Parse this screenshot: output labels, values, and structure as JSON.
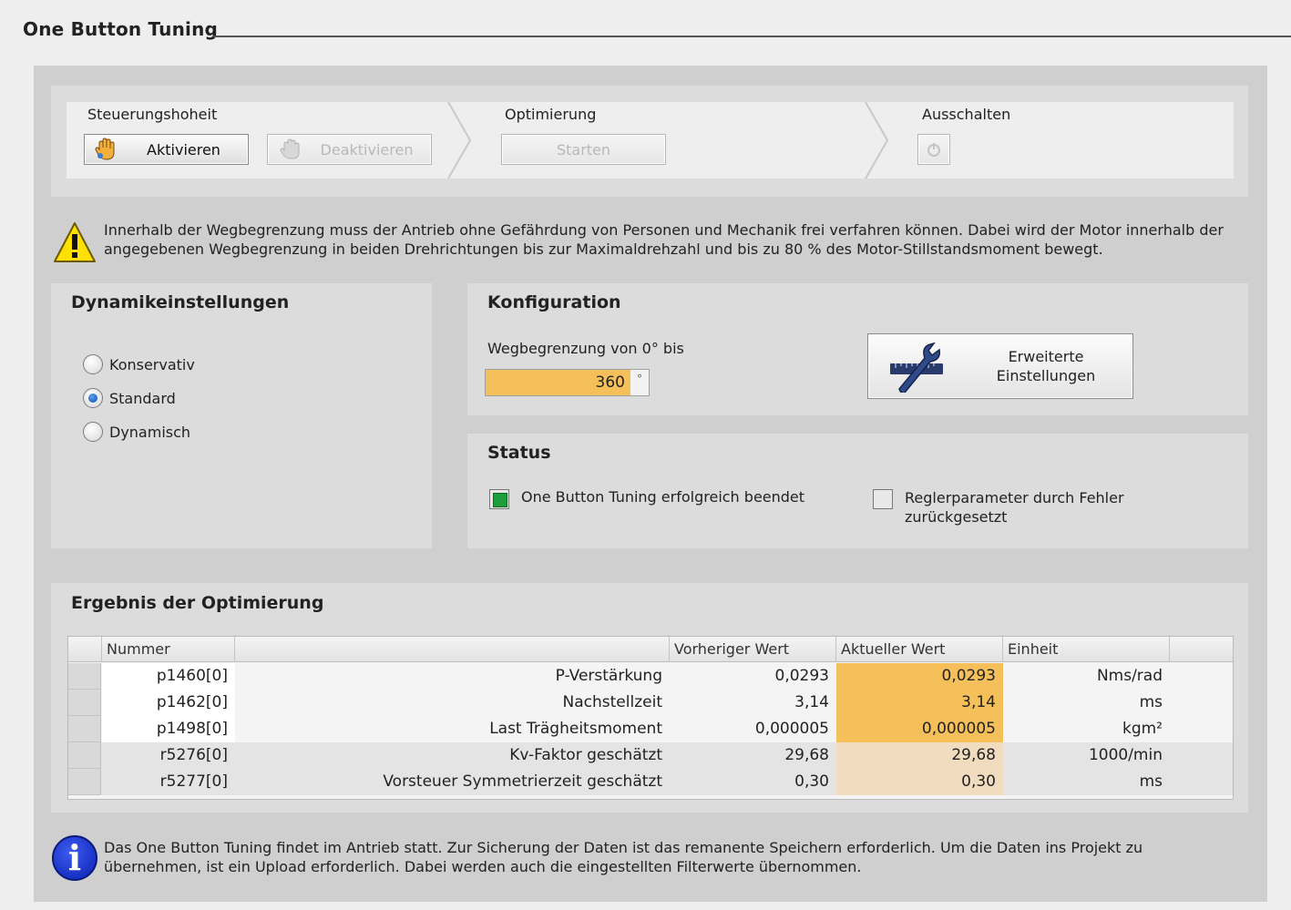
{
  "header": {
    "title": "One Button Tuning"
  },
  "steps": {
    "control": {
      "label": "Steuerungshoheit",
      "activate_label": "Aktivieren",
      "deactivate_label": "Deaktivieren"
    },
    "optimization": {
      "label": "Optimierung",
      "start_label": "Starten"
    },
    "shutdown": {
      "label": "Ausschalten"
    }
  },
  "warning": {
    "icon": "warning-icon",
    "text": "Innerhalb der Wegbegrenzung muss der Antrieb ohne Gefährdung von Personen und Mechanik frei verfahren können. Dabei wird der Motor innerhalb der angegebenen Wegbegrenzung in beiden Drehrichtungen bis zur Maximaldrehzahl und bis zu 80 % des Motor-Stillstandsmoment bewegt."
  },
  "dynamics": {
    "title": "Dynamikeinstellungen",
    "options": [
      {
        "label": "Konservativ",
        "selected": false
      },
      {
        "label": "Standard",
        "selected": true
      },
      {
        "label": "Dynamisch",
        "selected": false
      }
    ]
  },
  "configuration": {
    "title": "Konfiguration",
    "limit_label": "Wegbegrenzung von 0° bis",
    "limit_value": "360",
    "limit_unit": "°",
    "extended_button": "Erweiterte Einstellungen",
    "extended_icon": "wrench-ruler-icon"
  },
  "status": {
    "title": "Status",
    "items": [
      {
        "label": "One Button Tuning erfolgreich beendet",
        "state": "ok"
      },
      {
        "label": "Reglerparameter durch Fehler zurückgesetzt",
        "state": "off"
      }
    ]
  },
  "results": {
    "title": "Ergebnis der Optimierung",
    "columns": [
      "Nummer",
      "",
      "Vorheriger Wert",
      "Aktueller Wert",
      "Einheit"
    ],
    "rows": [
      {
        "number": "p1460[0]",
        "name": "P-Verstärkung",
        "previous": "0,0293",
        "current": "0,0293",
        "unit": "Nms/rad"
      },
      {
        "number": "p1462[0]",
        "name": "Nachstellzeit",
        "previous": "3,14",
        "current": "3,14",
        "unit": "ms"
      },
      {
        "number": "p1498[0]",
        "name": "Last Trägheitsmoment",
        "previous": "0,000005",
        "current": "0,000005",
        "unit": "kgm²"
      },
      {
        "number": "r5276[0]",
        "name": "Kv-Faktor geschätzt",
        "previous": "29,68",
        "current": "29,68",
        "unit": "1000/min"
      },
      {
        "number": "r5277[0]",
        "name": "Vorsteuer Symmetrierzeit geschätzt",
        "previous": "0,30",
        "current": "0,30",
        "unit": "ms"
      }
    ]
  },
  "info": {
    "icon": "info-icon",
    "text": "Das One Button Tuning findet im Antrieb statt. Zur Sicherung der Daten ist das remanente Speichern erforderlich. Um die Daten ins Projekt zu übernehmen, ist ein Upload erforderlich. Dabei werden auch die eingestellten Filterwerte übernommen."
  },
  "colors": {
    "editable_highlight": "#f5c05a",
    "readonly_highlight": "#f1dcc0",
    "status_ok": "#1e9e3a"
  }
}
